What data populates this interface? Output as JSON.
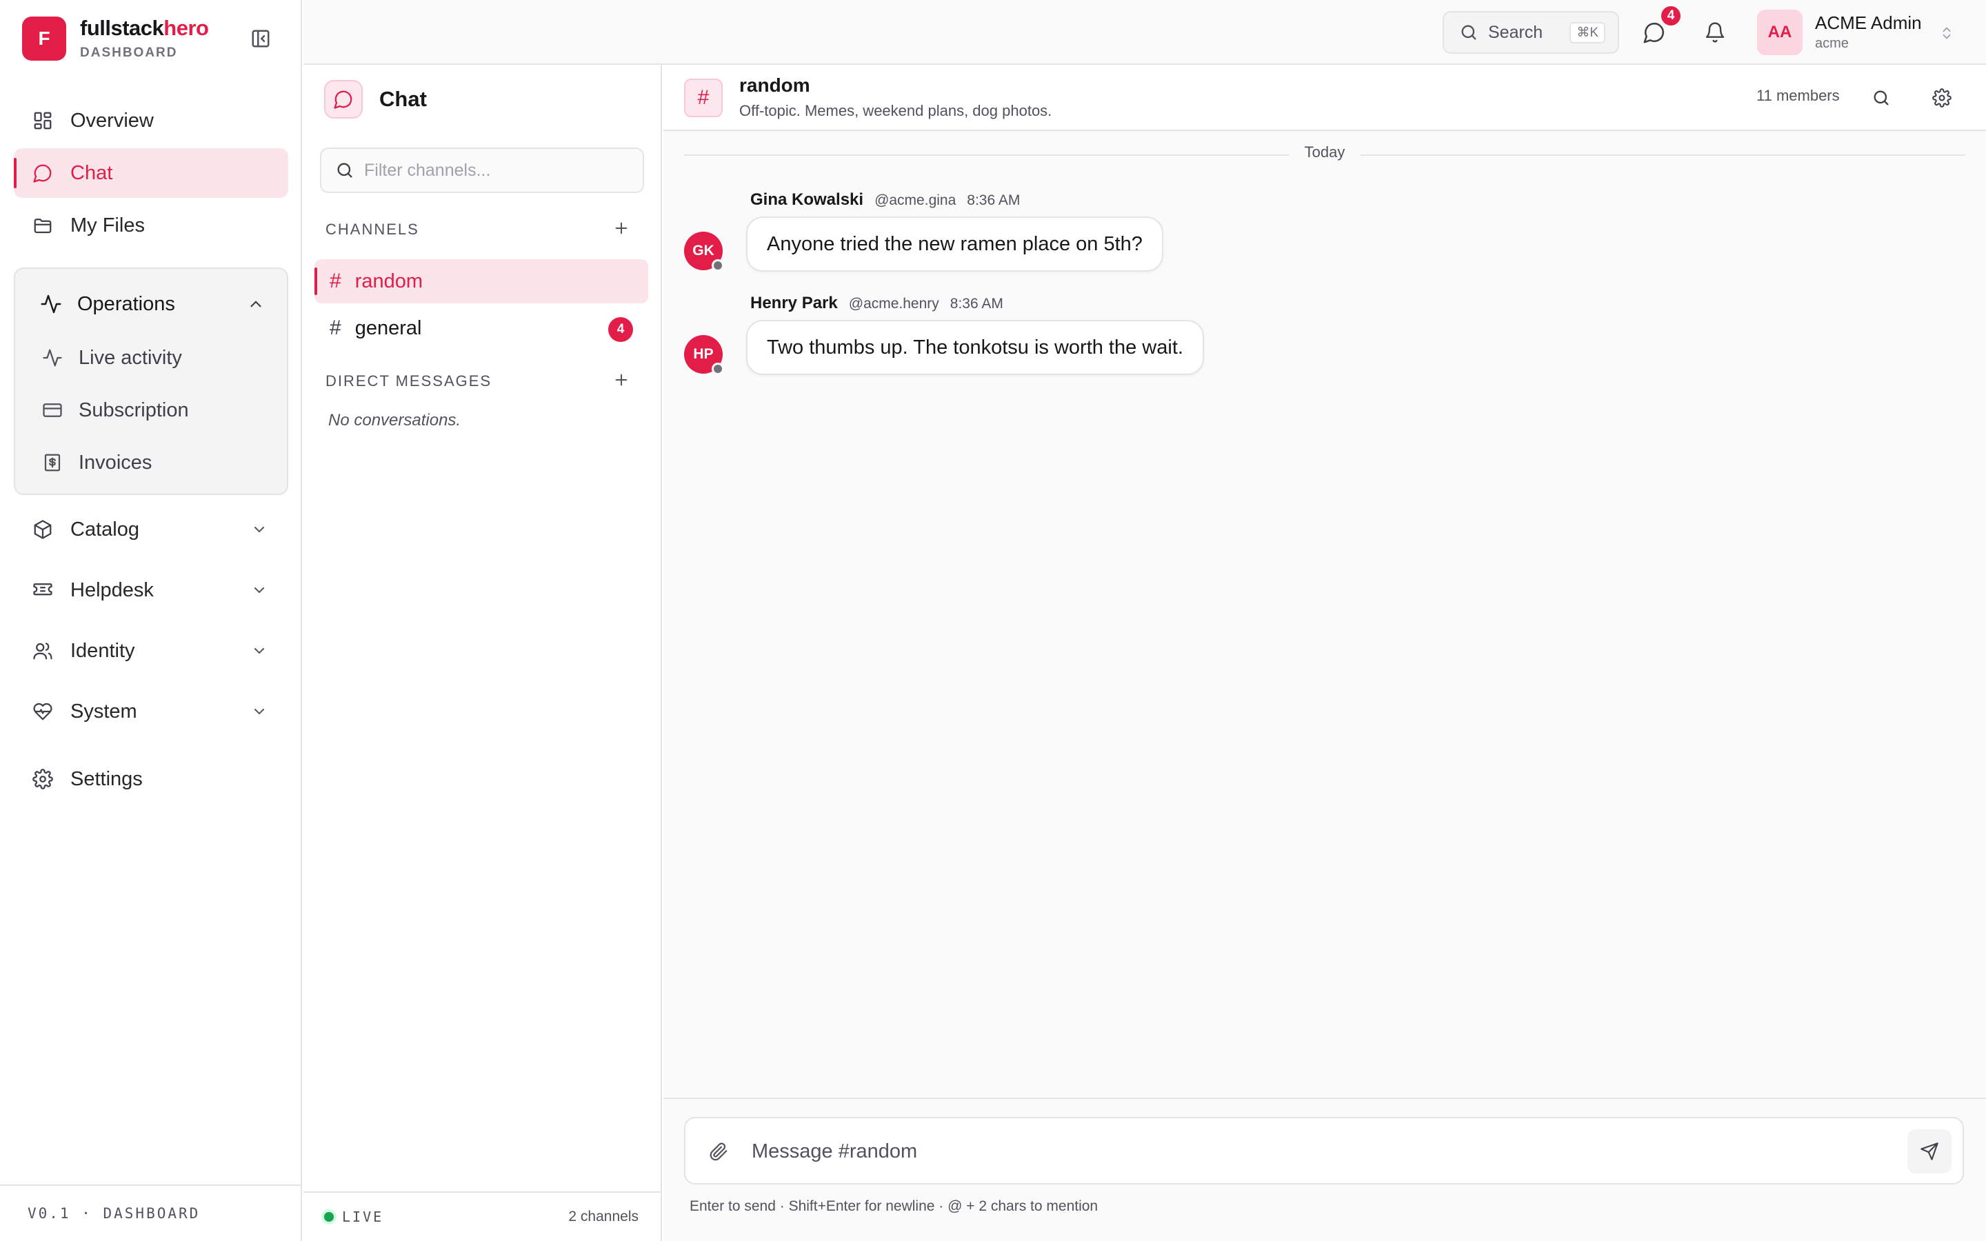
{
  "brand": {
    "initial": "F",
    "name_main": "fullstack",
    "name_accent": "hero",
    "subtitle": "DASHBOARD"
  },
  "sidebar": {
    "items": [
      {
        "label": "Overview",
        "icon": "grid-icon"
      },
      {
        "label": "Chat",
        "icon": "chat-bubble-icon",
        "active": true
      },
      {
        "label": "My Files",
        "icon": "folder-icon"
      }
    ],
    "operations": {
      "label": "Operations",
      "expanded": true,
      "children": [
        {
          "label": "Live activity",
          "icon": "activity-icon"
        },
        {
          "label": "Subscription",
          "icon": "credit-card-icon"
        },
        {
          "label": "Invoices",
          "icon": "invoice-icon"
        }
      ]
    },
    "groups": [
      {
        "label": "Catalog",
        "icon": "package-icon"
      },
      {
        "label": "Helpdesk",
        "icon": "ticket-icon"
      },
      {
        "label": "Identity",
        "icon": "users-icon"
      },
      {
        "label": "System",
        "icon": "heart-pulse-icon"
      }
    ],
    "settings": "Settings",
    "footer": "V0.1 · DASHBOARD"
  },
  "topbar": {
    "search_label": "Search",
    "search_shortcut": "⌘K",
    "chat_badge": "4",
    "user": {
      "initials": "AA",
      "name": "ACME Admin",
      "tenant": "acme"
    }
  },
  "channels_pane": {
    "title": "Chat",
    "filter_placeholder": "Filter channels...",
    "channels_label": "CHANNELS",
    "channels": [
      {
        "name": "random",
        "active": true,
        "unread": ""
      },
      {
        "name": "general",
        "active": false,
        "unread": "4"
      }
    ],
    "dm_label": "DIRECT MESSAGES",
    "dm_empty": "No conversations.",
    "live_label": "LIVE",
    "channel_count": "2 channels"
  },
  "conversation": {
    "channel": "random",
    "topic": "Off-topic. Memes, weekend plans, dog photos.",
    "members": "11 members",
    "day_label": "Today",
    "messages": [
      {
        "initials": "GK",
        "author": "Gina Kowalski",
        "handle": "@acme.gina",
        "time": "8:36 AM",
        "text": "Anyone tried the new ramen place on 5th?"
      },
      {
        "initials": "HP",
        "author": "Henry Park",
        "handle": "@acme.henry",
        "time": "8:36 AM",
        "text": "Two thumbs up. The tonkotsu is worth the wait."
      }
    ],
    "composer_placeholder": "Message #random",
    "composer_hint": "Enter to send · Shift+Enter for newline · @ + 2 chars to mention"
  },
  "colors": {
    "accent": "#e11d48",
    "accent_soft": "#fce7ee",
    "live": "#16a34a"
  }
}
